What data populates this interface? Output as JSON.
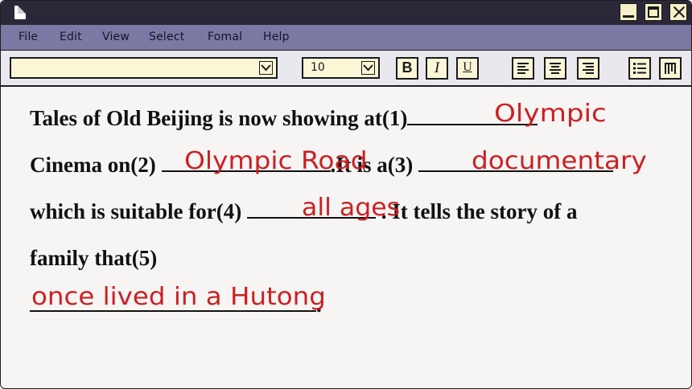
{
  "menu": [
    "File",
    "Edit",
    "View",
    "Select",
    "Fomal",
    "Help"
  ],
  "toolbar": {
    "font_name": "",
    "font_size": "10",
    "bold_label": "B",
    "italic_label": "I",
    "underline_label": "U"
  },
  "document": {
    "line1_text": "Tales of Old Beijing is now showing at(1)",
    "line2_text_a": "Cinema on(2)",
    "line2_text_b": "It is a(3)",
    "line3_text_a": "which is suitable for(4)",
    "line3_text_b": ". It tells the story of a",
    "line4_text": "family that(5)",
    "period": "."
  },
  "answers": {
    "a1": "Olympic",
    "a2": "Olympic Road",
    "a3": "documentary",
    "a4": "all ages",
    "a5": "once lived in a Hutong"
  },
  "colors": {
    "titlebar": "#2a2838",
    "menubar": "#7b79a3",
    "answer_ink": "#cc1f24",
    "input_fill": "#fbf6d6"
  }
}
